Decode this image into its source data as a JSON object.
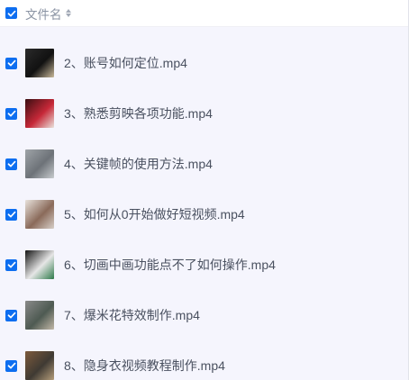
{
  "header": {
    "column_label": "文件名",
    "sort_icon": "sort-icon",
    "checkbox_icon": "check-icon"
  },
  "colors": {
    "checkbox": "#0d6ef0",
    "row_background": "#f5f5fd",
    "header_background": "#ffffff",
    "text": "#4a5160"
  },
  "files": [
    {
      "name": "2、账号如何定位.mp4",
      "thumb": [
        "#2b2b2b",
        "#111111",
        "#c9b99a"
      ]
    },
    {
      "name": "3、熟悉剪映各项功能.mp4",
      "thumb": [
        "#3a0e12",
        "#c62838",
        "#e9e2dc"
      ]
    },
    {
      "name": "4、关键帧的使用方法.mp4",
      "thumb": [
        "#9fa4a8",
        "#6d7278",
        "#c7cbce"
      ]
    },
    {
      "name": "5、如何从0开始做好短视频.mp4",
      "thumb": [
        "#e8e2dc",
        "#8a6a5a",
        "#d7cfc8"
      ]
    },
    {
      "name": "6、切画中画功能点不了如何操作.mp4",
      "thumb": [
        "#141414",
        "#e6e6e6",
        "#2e7a4a"
      ]
    },
    {
      "name": "7、爆米花特效制作.mp4",
      "thumb": [
        "#8a8a8a",
        "#4e5a52",
        "#c2b8a8"
      ]
    },
    {
      "name": "8、隐身衣视频教程制作.mp4",
      "thumb": [
        "#7d5a3c",
        "#3f3a33",
        "#b59d7a"
      ]
    }
  ]
}
